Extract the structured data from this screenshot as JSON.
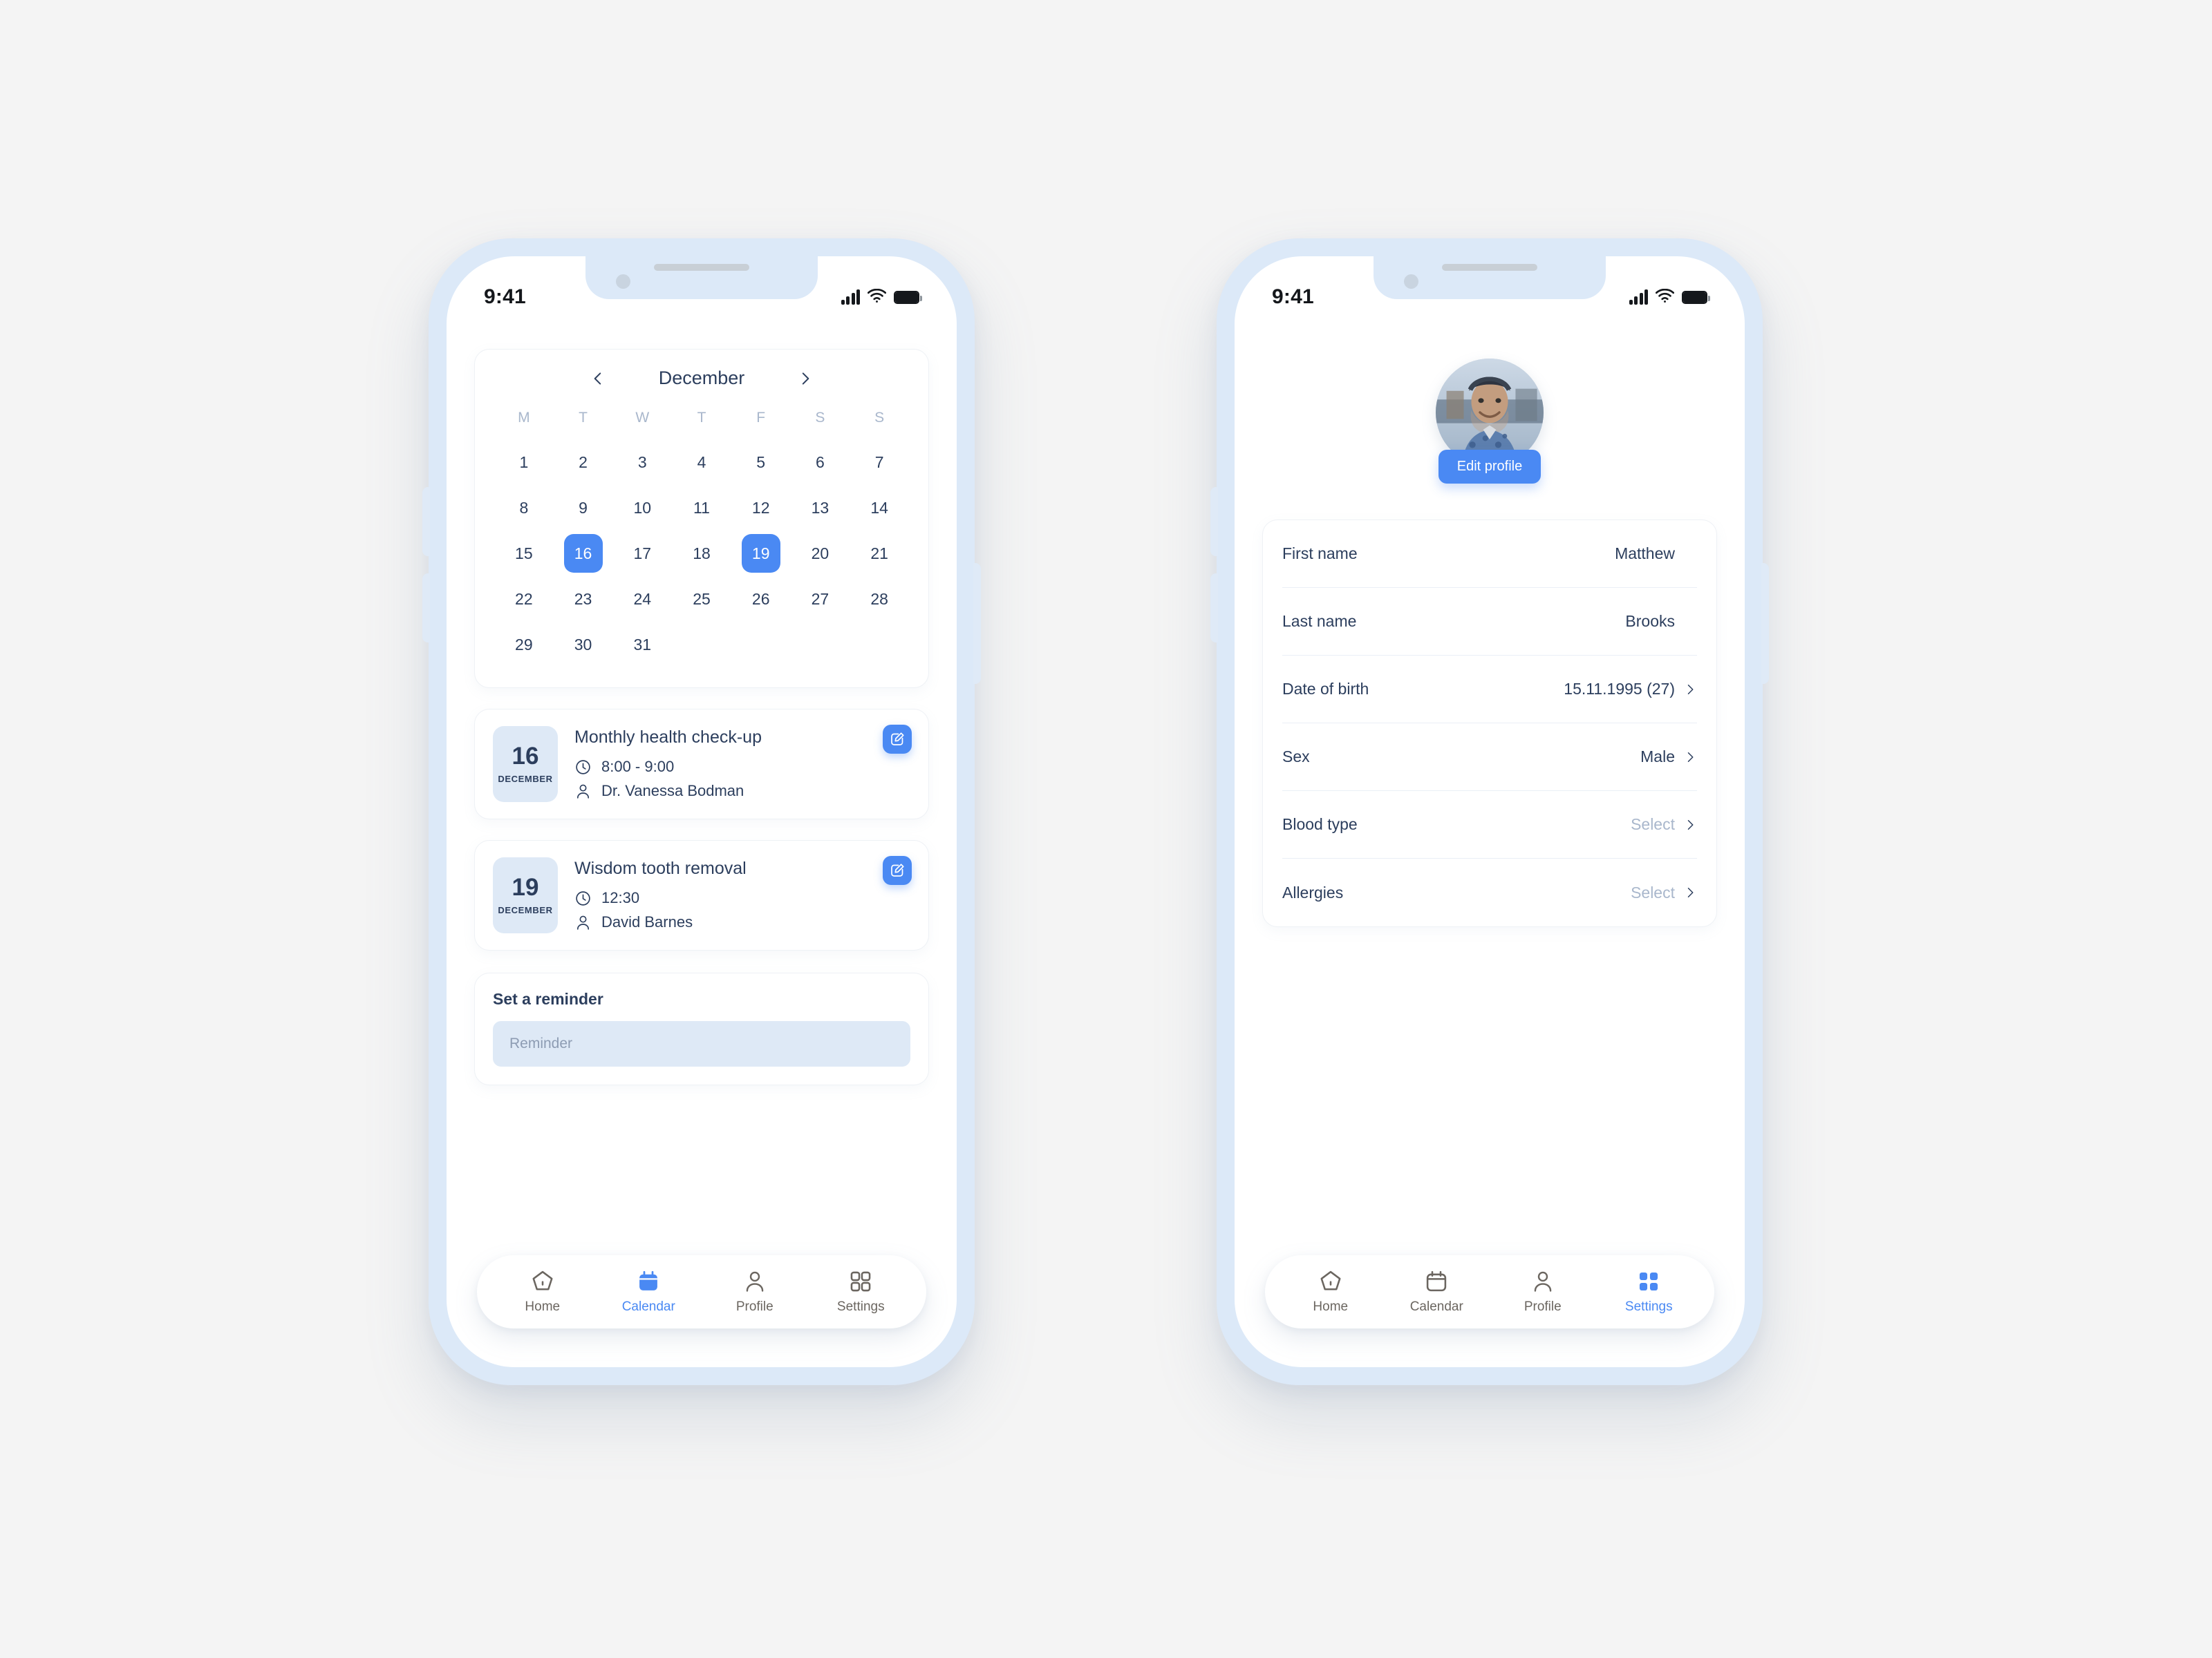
{
  "statusbar": {
    "time": "9:41",
    "signal_icon": "cellular-signal-icon",
    "wifi_icon": "wifi-icon",
    "battery_icon": "battery-full-icon"
  },
  "phone_left": {
    "calendar": {
      "month": "December",
      "prev_icon": "chevron-left-icon",
      "next_icon": "chevron-right-icon",
      "weekdays": [
        "M",
        "T",
        "W",
        "T",
        "F",
        "S",
        "S"
      ],
      "days": [
        1,
        2,
        3,
        4,
        5,
        6,
        7,
        8,
        9,
        10,
        11,
        12,
        13,
        14,
        15,
        16,
        17,
        18,
        19,
        20,
        21,
        22,
        23,
        24,
        25,
        26,
        27,
        28,
        29,
        30,
        31
      ],
      "selected_days": [
        16,
        19
      ]
    },
    "appointments": [
      {
        "day": "16",
        "month": "DECEMBER",
        "title": "Monthly health check-up",
        "time": "8:00 - 9:00",
        "person": "Dr. Vanessa Bodman",
        "clock_icon": "clock-icon",
        "person_icon": "person-icon",
        "edit_icon": "edit-pencil-icon"
      },
      {
        "day": "19",
        "month": "DECEMBER",
        "title": "Wisdom tooth removal",
        "time": "12:30",
        "person": "David Barnes",
        "clock_icon": "clock-icon",
        "person_icon": "person-icon",
        "edit_icon": "edit-pencil-icon"
      }
    ],
    "reminder": {
      "label": "Set a reminder",
      "placeholder": "Reminder",
      "value": ""
    },
    "tabs": [
      {
        "label": "Home",
        "icon": "home-icon",
        "active": false
      },
      {
        "label": "Calendar",
        "icon": "calendar-icon",
        "active": true
      },
      {
        "label": "Profile",
        "icon": "person-icon",
        "active": false
      },
      {
        "label": "Settings",
        "icon": "grid-squares-icon",
        "active": false
      }
    ]
  },
  "phone_right": {
    "avatar_alt": "user-avatar-photo",
    "edit_profile_label": "Edit profile",
    "fields": [
      {
        "label": "First name",
        "value": "Matthew",
        "muted": false,
        "chevron": false
      },
      {
        "label": "Last name",
        "value": "Brooks",
        "muted": false,
        "chevron": false
      },
      {
        "label": "Date of birth",
        "value": "15.11.1995 (27)",
        "muted": false,
        "chevron": true
      },
      {
        "label": "Sex",
        "value": "Male",
        "muted": false,
        "chevron": true
      },
      {
        "label": "Blood type",
        "value": "Select",
        "muted": true,
        "chevron": true
      },
      {
        "label": "Allergies",
        "value": "Select",
        "muted": true,
        "chevron": true
      }
    ],
    "tabs": [
      {
        "label": "Home",
        "icon": "home-icon",
        "active": false
      },
      {
        "label": "Calendar",
        "icon": "calendar-icon",
        "active": false
      },
      {
        "label": "Profile",
        "icon": "person-icon",
        "active": false
      },
      {
        "label": "Settings",
        "icon": "grid-squares-icon",
        "active": true
      }
    ]
  },
  "colors": {
    "accent_blue": "#4a89f3",
    "navy_text": "#2c3e5d",
    "frame_blue": "#dce9f8",
    "badge_blue": "#dee9f6",
    "background": "#f4f4f4",
    "muted_text": "#a9b7cc"
  }
}
